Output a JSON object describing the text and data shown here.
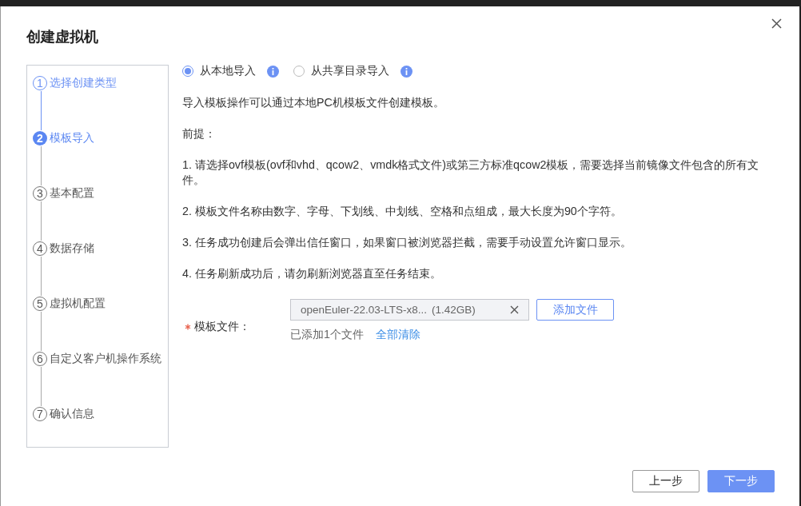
{
  "dialog": {
    "title": "创建虚拟机"
  },
  "steps": [
    {
      "number": "1",
      "label": "选择创建类型",
      "completed": true,
      "current": false
    },
    {
      "number": "2",
      "label": "模板导入",
      "completed": false,
      "current": true
    },
    {
      "number": "3",
      "label": "基本配置",
      "completed": false,
      "current": false
    },
    {
      "number": "4",
      "label": "数据存储",
      "completed": false,
      "current": false
    },
    {
      "number": "5",
      "label": "虚拟机配置",
      "completed": false,
      "current": false
    },
    {
      "number": "6",
      "label": "自定义客户机操作系统",
      "completed": false,
      "current": false
    },
    {
      "number": "7",
      "label": "确认信息",
      "completed": false,
      "current": false
    }
  ],
  "import_source": [
    {
      "label": "从本地导入",
      "selected": true
    },
    {
      "label": "从共享目录导入",
      "selected": false
    }
  ],
  "intro": "导入模板操作可以通过本地PC机模板文件创建模板。",
  "prerequisite_heading": "前提：",
  "notes": [
    "1. 请选择ovf模板(ovf和vhd、qcow2、vmdk格式文件)或第三方标准qcow2模板，需要选择当前镜像文件包含的所有文件。",
    "2. 模板文件名称由数字、字母、下划线、中划线、空格和点组成，最大长度为90个字符。",
    "3. 任务成功创建后会弹出信任窗口，如果窗口被浏览器拦截，需要手动设置允许窗口显示。",
    "4. 任务刷新成功后，请勿刷新浏览器直至任务结束。"
  ],
  "template_file": {
    "label": "模板文件：",
    "required": true,
    "file_name": "openEuler-22.03-LTS-x8...",
    "file_size": "(1.42GB)",
    "add_button": "添加文件",
    "summary": "已添加1个文件",
    "clear_link": "全部清除"
  },
  "buttons": [
    {
      "label": "上一步",
      "kind": "secondary"
    },
    {
      "label": "下一步",
      "kind": "primary"
    }
  ]
}
